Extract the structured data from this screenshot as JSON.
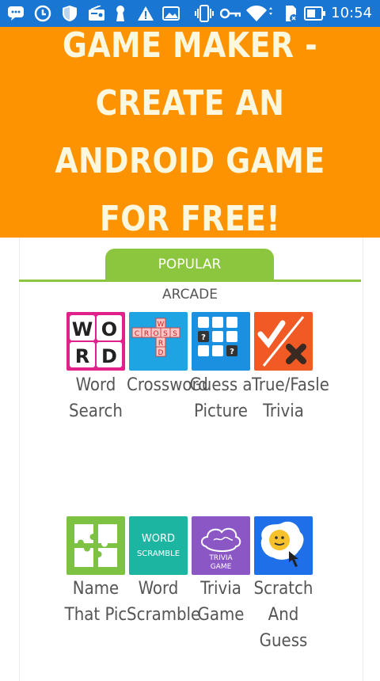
{
  "status_bar": {
    "time": "10:54",
    "icons": [
      "chat-icon",
      "sync-icon",
      "shield-icon",
      "radio-icon",
      "keyhole-icon",
      "warning-icon",
      "image-icon",
      "vibrate-icon",
      "key-icon",
      "wifi-icon",
      "sim-icon",
      "battery-icon"
    ]
  },
  "banner": {
    "title": "GAME MAKER - CREATE AN ANDROID GAME FOR FREE!",
    "color": "#fd9301"
  },
  "tabs": {
    "active": "POPULAR"
  },
  "section_heading": "ARCADE",
  "games": [
    {
      "label": "Word Search",
      "icon": "word-search-icon",
      "tile_text": [
        "W",
        "O",
        "R",
        "D"
      ]
    },
    {
      "label": "Crossword",
      "icon": "crossword-icon",
      "tile_text": [
        "W",
        "C",
        "R",
        "O",
        "S",
        "S",
        "R",
        "D"
      ]
    },
    {
      "label": "Guess a Picture",
      "icon": "guess-picture-icon",
      "tile_text": [
        "?",
        "?"
      ]
    },
    {
      "label": "True/Fasle Trivia",
      "icon": "true-false-icon"
    },
    {
      "label": "Name That Pic",
      "icon": "name-that-pic-icon"
    },
    {
      "label": "Word Scramble",
      "icon": "word-scramble-icon",
      "tile_text": [
        "WORD",
        "SCRAMBLE"
      ]
    },
    {
      "label": "Trivia Game",
      "icon": "trivia-game-icon",
      "tile_text": [
        "TRIVIA",
        "GAME"
      ]
    },
    {
      "label": "Scratch And Guess",
      "icon": "scratch-guess-icon"
    }
  ],
  "colors": {
    "status_bar": "#1976d2",
    "tab_active": "#8cc63f",
    "word_search": "#e0218a",
    "crossword": "#1ea4e3",
    "guess_picture": "#1b8fe0",
    "true_false": "#f15a24",
    "name_that_pic": "#7dc242",
    "word_scramble": "#1bb5a1",
    "trivia_game": "#8b57c4",
    "scratch_guess": "#1e6fe8"
  }
}
